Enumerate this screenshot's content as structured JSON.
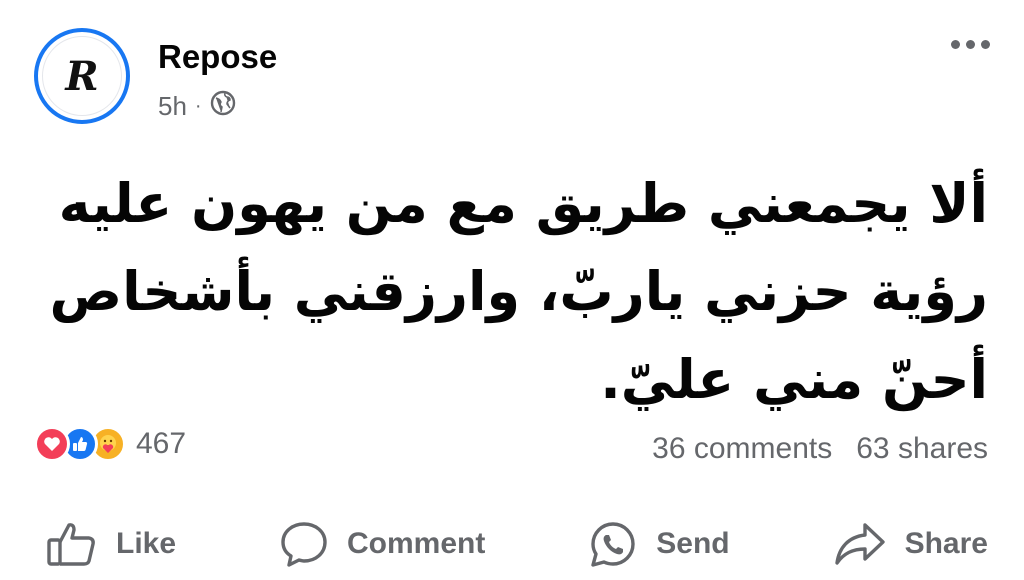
{
  "post": {
    "author": "Repose",
    "avatar_letter": "R",
    "time": "5h",
    "separator": "·",
    "audience_icon": "globe-icon",
    "more_icon": "more-options-icon",
    "text_lines": [
      "ألا يجمعني طريق مع من يهون عليه",
      "رؤية حزني ياربّ، وارزقني بأشخاص",
      "أحنّ مني عليّ."
    ]
  },
  "reactions": {
    "icons": [
      "love-reaction-icon",
      "like-reaction-icon",
      "care-reaction-icon"
    ],
    "count": "467"
  },
  "stats": {
    "comments": "36 comments",
    "shares": "63 shares"
  },
  "actions": {
    "like": "Like",
    "comment": "Comment",
    "send": "Send",
    "share": "Share"
  },
  "colors": {
    "accent": "#1877f2",
    "secondary_text": "#65676b",
    "love": "#f33e58",
    "care": "#f7b125"
  }
}
